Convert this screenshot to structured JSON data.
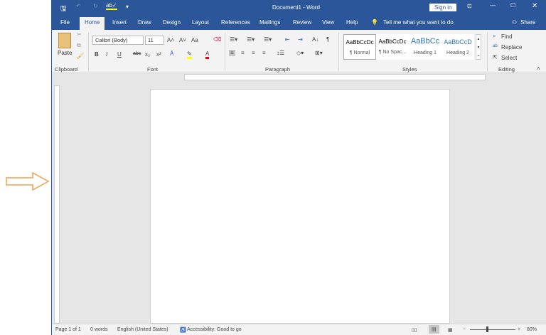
{
  "window_title": "Document1 - Word",
  "sign_in": "Sign in",
  "tabs": [
    "File",
    "Home",
    "Insert",
    "Draw",
    "Design",
    "Layout",
    "References",
    "Mailings",
    "Review",
    "View",
    "Help"
  ],
  "tell_me": "Tell me what you want to do",
  "share": "Share",
  "clipboard": {
    "paste": "Paste",
    "group": "Clipboard"
  },
  "font": {
    "name": "Calibri (Body)",
    "size": "11",
    "change_case": "Aa",
    "group": "Font",
    "bold": "B",
    "italic": "I",
    "underline": "U",
    "strike": "abc",
    "sub": "x₂",
    "sup": "x²"
  },
  "paragraph": {
    "group": "Paragraph"
  },
  "styles": {
    "group": "Styles",
    "items": [
      {
        "preview": "AaBbCcDc",
        "label": "¶ Normal"
      },
      {
        "preview": "AaBbCcDc",
        "label": "¶ No Spac..."
      },
      {
        "preview": "AaBbCc",
        "label": "Heading 1"
      },
      {
        "preview": "AaBbCcD",
        "label": "Heading 2"
      }
    ]
  },
  "editing": {
    "group": "Editing",
    "find": "Find",
    "replace": "Replace",
    "select": "Select"
  },
  "status": {
    "page": "Page 1 of 1",
    "words": "0 words",
    "language": "English (United States)",
    "accessibility": "Accessibility: Good to go",
    "zoom": "80%",
    "zoom_minus": "−",
    "zoom_plus": "+"
  },
  "colors": {
    "brand": "#2b579a",
    "arrow": "#f0a050"
  }
}
